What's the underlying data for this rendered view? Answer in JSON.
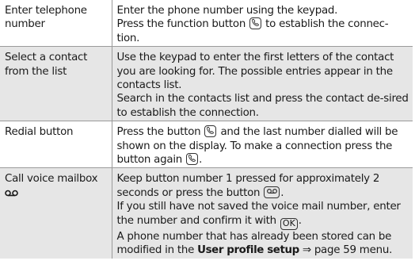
{
  "rows": [
    {
      "label": "Enter telephone number",
      "p1": "Enter the phone number using the keypad.",
      "p2a": "Press the function button",
      "p2b": "to establish the connec-tion."
    },
    {
      "label": "Select a contact from the list",
      "p1": "Use the keypad to enter the first letters of the contact you are looking for. The possible entries appear in the contacts list.",
      "p2": "Search in the contacts list and press the contact de-sired to establish the connection."
    },
    {
      "label": "Redial button",
      "p1a": "Press the button",
      "p1b": "and the last number dialled will be shown on the display. To make a connection press the button again",
      "p1c": "."
    },
    {
      "label": "Call voice mailbox",
      "p1a": "Keep button number 1 pressed for approximately 2 seconds or press the button",
      "p1b": ".",
      "p2a": "If you still have not saved the voice mail number, enter the number and confirm it with",
      "ok_label": "OK",
      "p2b": ".",
      "p3a": "A phone number that has already been stored can be modified in the",
      "p3_bold": "User profile setup",
      "p3_arrow": "⇒",
      "p3b": "page 59 menu."
    }
  ]
}
